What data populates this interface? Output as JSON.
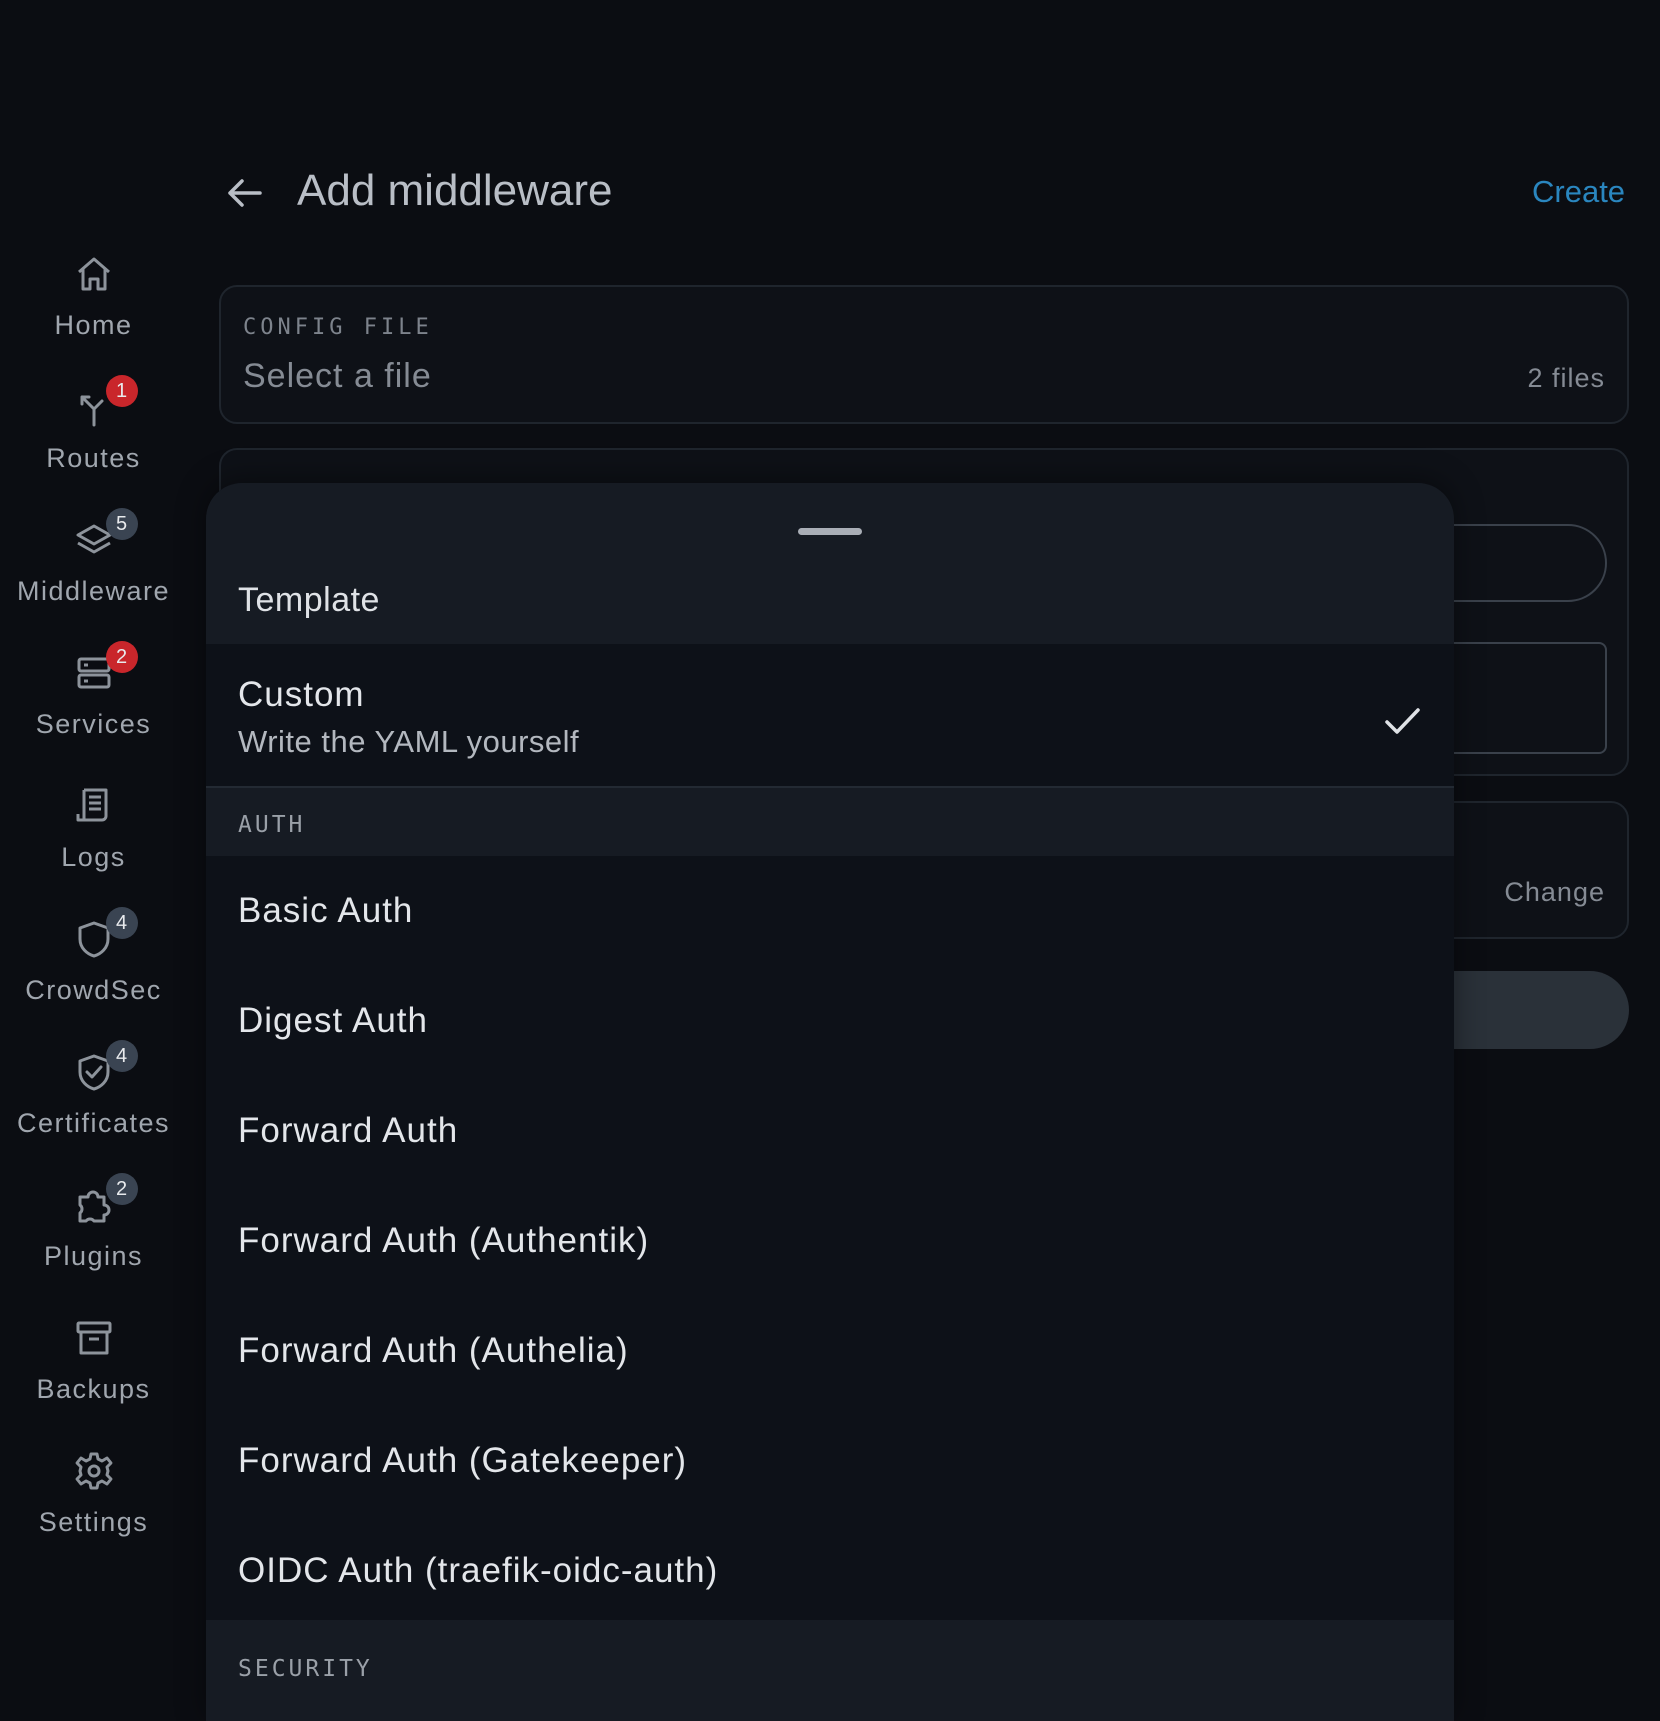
{
  "sidebar": {
    "items": [
      {
        "label": "Home",
        "icon": "home-icon",
        "badge": ""
      },
      {
        "label": "Routes",
        "icon": "routes-icon",
        "badge": "1",
        "badge_color": "#c9262b"
      },
      {
        "label": "Middleware",
        "icon": "layers-icon",
        "badge": "5",
        "badge_color": "#3a4452"
      },
      {
        "label": "Services",
        "icon": "server-icon",
        "badge": "2",
        "badge_color": "#c9262b"
      },
      {
        "label": "Logs",
        "icon": "logs-icon",
        "badge": ""
      },
      {
        "label": "CrowdSec",
        "icon": "shield-icon",
        "badge": "4",
        "badge_color": "#3a4452"
      },
      {
        "label": "Certificates",
        "icon": "shield-check-icon",
        "badge": "4",
        "badge_color": "#3a4452"
      },
      {
        "label": "Plugins",
        "icon": "puzzle-icon",
        "badge": "2",
        "badge_color": "#3a4452"
      },
      {
        "label": "Backups",
        "icon": "archive-icon",
        "badge": ""
      },
      {
        "label": "Settings",
        "icon": "gear-icon",
        "badge": ""
      }
    ]
  },
  "header": {
    "title": "Add middleware",
    "create_label": "Create",
    "accent_color": "#2a86bf"
  },
  "form": {
    "config_file": {
      "label": "CONFIG FILE",
      "placeholder": "Select a file",
      "count": "2 files"
    },
    "change_label": "Change"
  },
  "sheet": {
    "title": "Template",
    "custom": {
      "title": "Custom",
      "subtitle": "Write the YAML yourself",
      "selected": true
    },
    "sections": [
      {
        "label": "AUTH",
        "items": [
          "Basic Auth",
          "Digest Auth",
          "Forward Auth",
          "Forward Auth (Authentik)",
          "Forward Auth (Authelia)",
          "Forward Auth (Gatekeeper)",
          "OIDC Auth (traefik-oidc-auth)"
        ]
      },
      {
        "label": "SECURITY",
        "items": []
      }
    ]
  }
}
